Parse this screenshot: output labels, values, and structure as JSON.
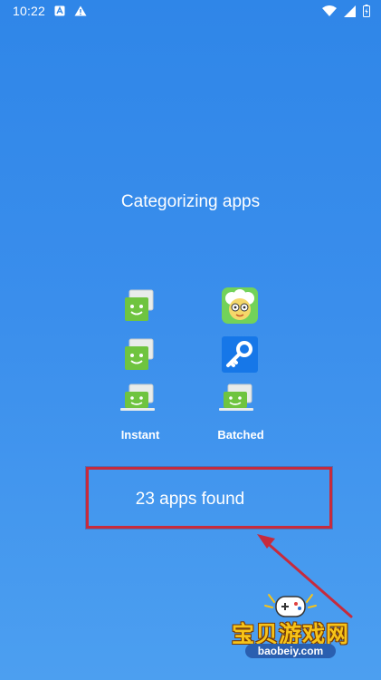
{
  "status_bar": {
    "time": "10:22",
    "left_icons": [
      "a-notification-icon",
      "warning-icon"
    ],
    "right_icons": [
      "wifi-icon",
      "signal-icon",
      "battery-icon"
    ]
  },
  "screen": {
    "title": "Categorizing apps",
    "columns": [
      {
        "label": "Instant",
        "apps": [
          "messaging-app-icon",
          "messaging-app-icon",
          "messaging-app-icon"
        ]
      },
      {
        "label": "Batched",
        "apps": [
          "cartoon-app-icon",
          "key-app-icon",
          "messaging-app-icon"
        ]
      }
    ],
    "result_text": "23 apps found"
  },
  "annotation": {
    "box_color": "#c62b3d",
    "arrow_color": "#c62b3d"
  },
  "watermark": {
    "title": "宝贝游戏网",
    "url": "baobeiy.com"
  },
  "colors": {
    "background_top": "#2f86e8",
    "background_bottom": "#4c9ff0",
    "app_green": "#6fc43f",
    "watermark_yellow": "#f6c319"
  }
}
